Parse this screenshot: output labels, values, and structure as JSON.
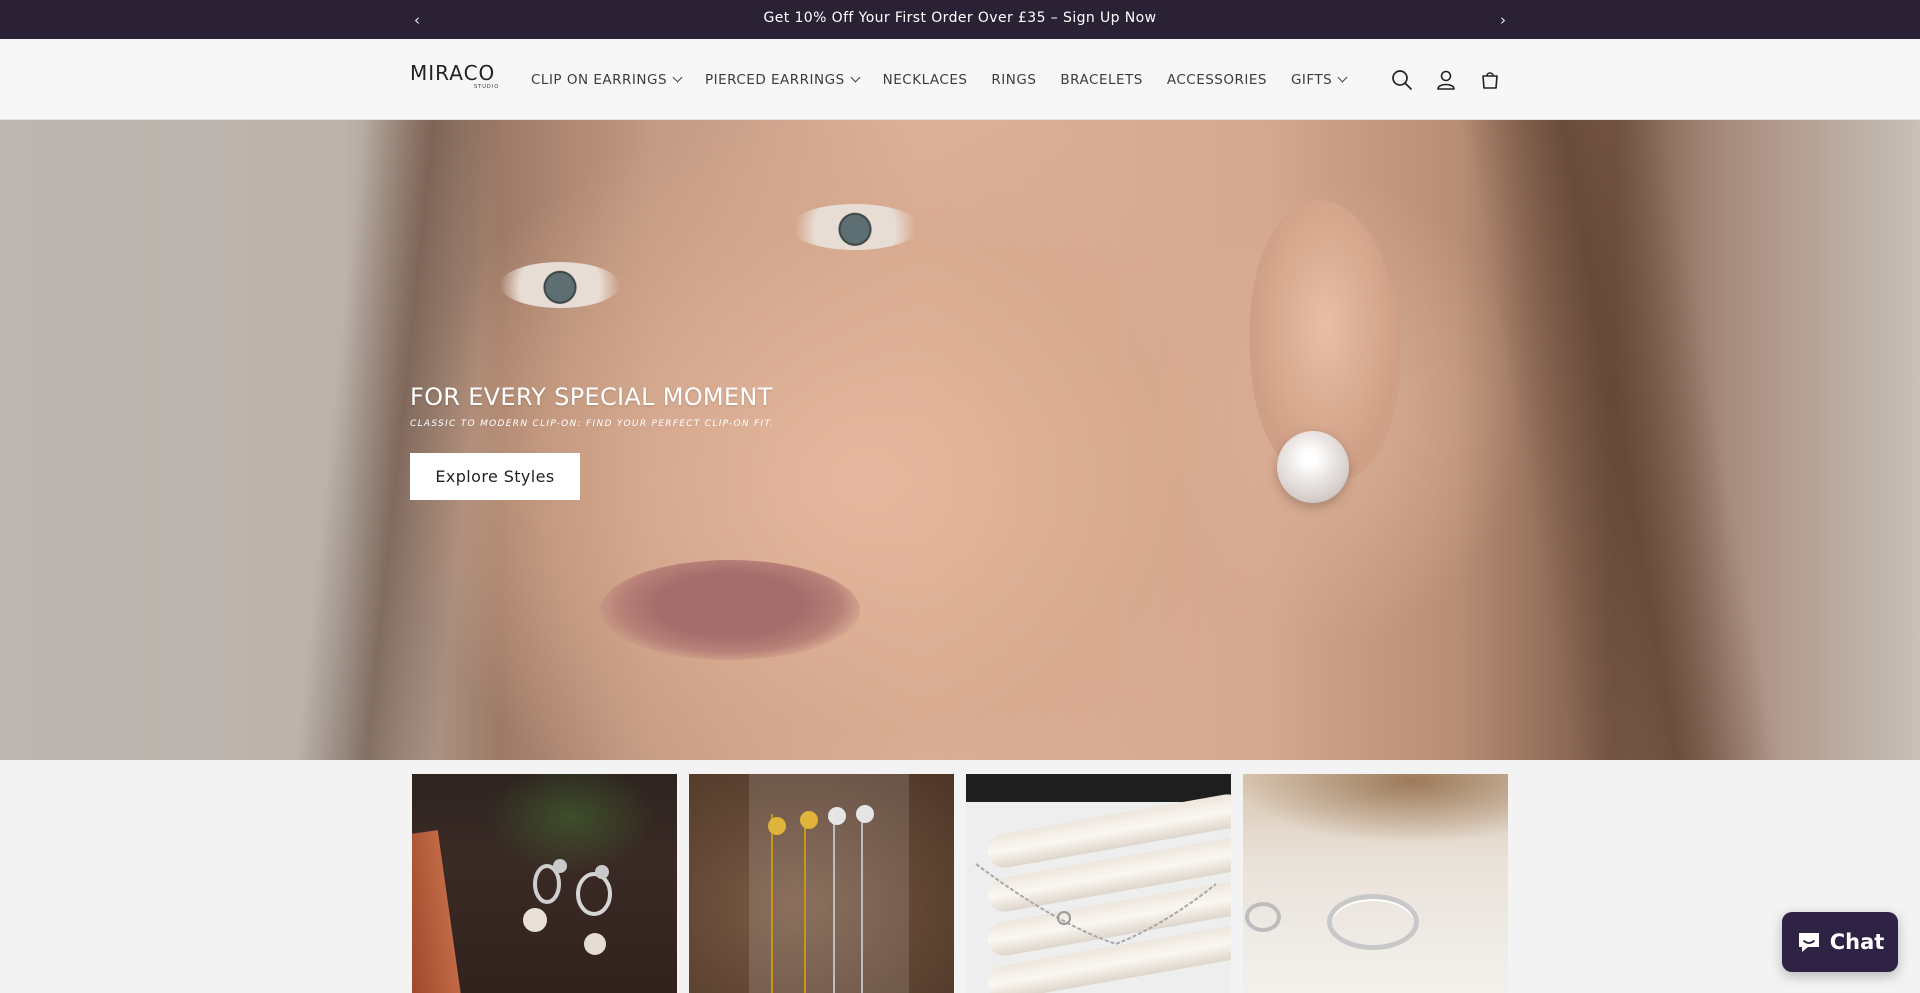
{
  "announcement": {
    "text": "Get 10% Off Your First Order Over £35 – Sign Up Now",
    "prev_arrow": "‹",
    "next_arrow": "›"
  },
  "header": {
    "logo_text": "MIRACO",
    "logo_subtext": "STUDIO",
    "nav": [
      {
        "label": "CLIP ON EARRINGS",
        "has_dropdown": true
      },
      {
        "label": "PIERCED EARRINGS",
        "has_dropdown": true
      },
      {
        "label": "NECKLACES",
        "has_dropdown": false
      },
      {
        "label": "RINGS",
        "has_dropdown": false
      },
      {
        "label": "BRACELETS",
        "has_dropdown": false
      },
      {
        "label": "ACCESSORIES",
        "has_dropdown": false
      },
      {
        "label": "GIFTS",
        "has_dropdown": true
      }
    ],
    "icons": [
      "search-icon",
      "account-icon",
      "cart-icon"
    ]
  },
  "hero": {
    "title": "FOR EVERY SPECIAL MOMENT",
    "subtitle": "CLASSIC TO MODERN CLIP-ON: FIND YOUR PERFECT CLIP-ON FIT.",
    "button_label": "Explore Styles"
  },
  "tiles": [
    "pearl-drop-earrings-image",
    "flower-drop-earrings-image",
    "silver-necklace-image",
    "silver-ring-image"
  ],
  "chat": {
    "label": "Chat",
    "icon": "chat-bubble-icon",
    "color": "#2e2344"
  },
  "colors": {
    "announcement_bg": "#2b2135",
    "header_bg": "#f7f7f7"
  }
}
